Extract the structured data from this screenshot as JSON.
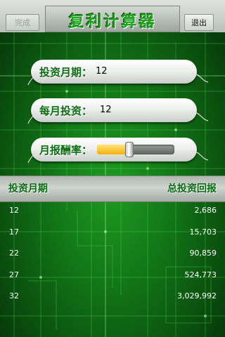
{
  "header": {
    "done_label": "完成",
    "title": "复利计算器",
    "exit_label": "退出"
  },
  "form": {
    "period_label": "投资月期：",
    "period_value": "12",
    "monthly_label": "每月投资：",
    "monthly_value": "12",
    "rate_label": "月报酬率：",
    "rate_level": 0.42
  },
  "results": {
    "col_period": "投资月期",
    "col_total": "总投资回报",
    "rows": [
      {
        "period": "12",
        "total": "2,686"
      },
      {
        "period": "17",
        "total": "15,703"
      },
      {
        "period": "22",
        "total": "90,859"
      },
      {
        "period": "27",
        "total": "524,773"
      },
      {
        "period": "32",
        "total": "3,029,992"
      }
    ]
  },
  "colors": {
    "accent_green": "#0b6c12",
    "background_green": "#137a18",
    "slider_fill": "#f3b10c"
  }
}
